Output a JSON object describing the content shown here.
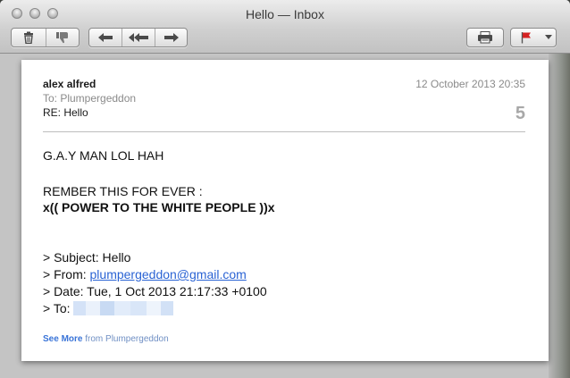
{
  "window": {
    "title": "Hello — Inbox"
  },
  "toolbar": {
    "delete_icon": "trash-icon",
    "junk_icon": "thumbs-down-icon",
    "reply_icon": "reply-arrow-icon",
    "reply_all_icon": "reply-all-arrow-icon",
    "forward_icon": "forward-arrow-icon",
    "print_icon": "printer-icon",
    "flag_icon": "red-flag-icon",
    "flag_menu_icon": "chevron-down-icon",
    "flag_color": "#d42323"
  },
  "message": {
    "from": "alex alfred",
    "date": "12 October 2013 20:35",
    "to_line": "To:  Plumpergeddon",
    "subject": "RE: Hello",
    "count": "5",
    "body": {
      "line1": "G.A.Y MAN LOL HAH",
      "line2": "REMBER THIS FOR EVER :",
      "line3": "x(( POWER TO THE WHITE PEOPLE ))x"
    },
    "quoted": {
      "subject": "> Subject: Hello",
      "from_label": "> From: ",
      "from_email": "plumpergeddon@gmail.com",
      "date": "> Date: Tue, 1 Oct 2013 21:17:33 +0100",
      "to_label": "> To: "
    },
    "see_more_link": "See More",
    "see_more_rest": " from Plumpergeddon",
    "link_color": "#2a63d4"
  }
}
